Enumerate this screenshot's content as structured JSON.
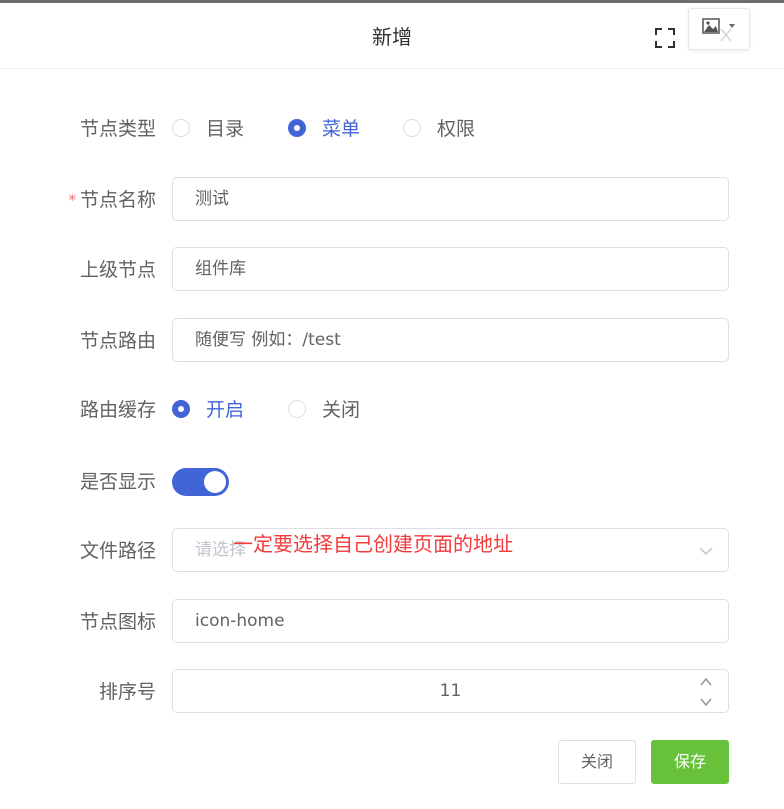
{
  "dialog": {
    "title": "新增"
  },
  "form": {
    "node_type": {
      "label": "节点类型",
      "options": [
        "目录",
        "菜单",
        "权限"
      ],
      "selected": "菜单"
    },
    "node_name": {
      "required_mark": "*",
      "label": "节点名称",
      "value": "测试"
    },
    "parent_node": {
      "label": "上级节点",
      "value": "组件库"
    },
    "node_route": {
      "label": "节点路由",
      "value": "随便写 例如：/test"
    },
    "route_cache": {
      "label": "路由缓存",
      "options": [
        "开启",
        "关闭"
      ],
      "selected": "开启"
    },
    "show": {
      "label": "是否显示",
      "on": true
    },
    "file_path": {
      "label": "文件路径",
      "placeholder": "请选择"
    },
    "node_icon": {
      "label": "节点图标",
      "value": "icon-home"
    },
    "sort": {
      "label": "排序号",
      "value": "11"
    }
  },
  "annotation": "一定要选择自己创建页面的地址",
  "footer": {
    "close_label": "关闭",
    "save_label": "保存"
  },
  "colors": {
    "primary": "#4165d7",
    "success": "#67c23a",
    "annotation": "#f23b3b",
    "required": "#f56c6c"
  },
  "icons": [
    "fullscreen-icon",
    "image-icon",
    "caret-down-icon",
    "close-icon",
    "chevron-down-icon",
    "chevron-up-icon"
  ]
}
